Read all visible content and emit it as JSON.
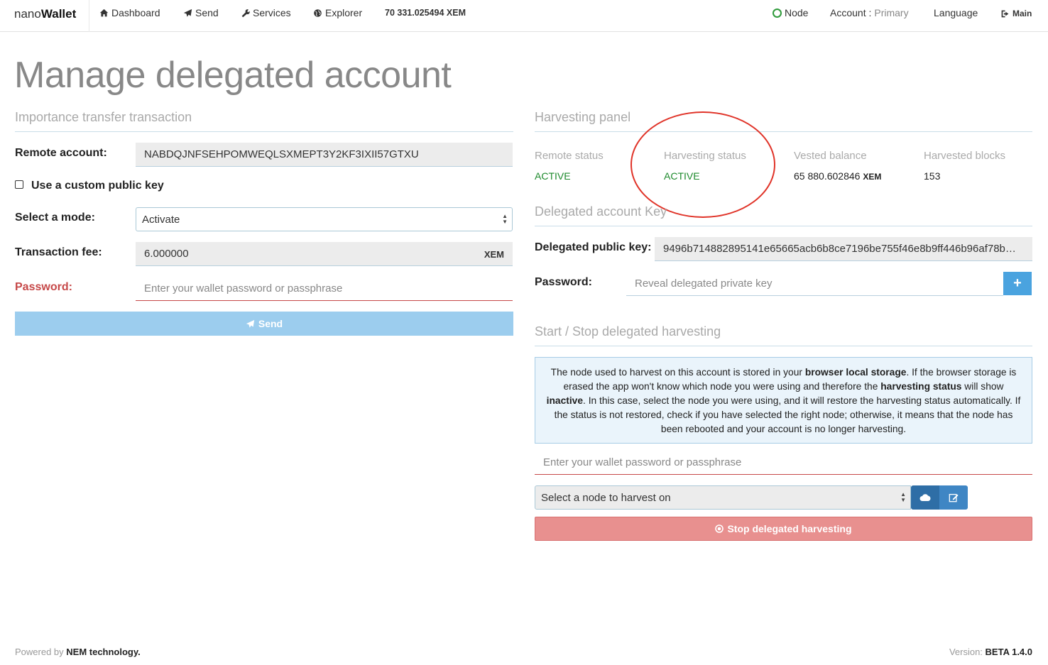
{
  "navbar": {
    "brand_light": "nano",
    "brand_bold": "Wallet",
    "dashboard": "Dashboard",
    "send": "Send",
    "services": "Services",
    "explorer": "Explorer",
    "balance": "70 331.025494 XEM",
    "node": "Node",
    "account_label": "Account : ",
    "account_name": "Primary",
    "language": "Language",
    "main": "Main"
  },
  "page": {
    "title": "Manage delegated account"
  },
  "importance": {
    "section_title": "Importance transfer transaction",
    "remote_label": "Remote account:",
    "remote_value": "NABDQJNFSEHPOMWEQLSXMEPT3Y2KF3IXII57GTXU",
    "custom_key_label": "Use a custom public key",
    "mode_label": "Select a mode:",
    "mode_value": "Activate",
    "fee_label": "Transaction fee:",
    "fee_value": "6.000000",
    "fee_unit": "XEM",
    "password_label": "Password:",
    "password_placeholder": "Enter your wallet password or passphrase",
    "send_button": "Send"
  },
  "harvesting": {
    "section_title": "Harvesting panel",
    "remote_status_label": "Remote status",
    "remote_status_value": "ACTIVE",
    "harvest_status_label": "Harvesting status",
    "harvest_status_value": "ACTIVE",
    "vested_label": "Vested balance",
    "vested_value": "65 880.602846",
    "vested_unit": "XEM",
    "blocks_label": "Harvested blocks",
    "blocks_value": "153"
  },
  "delegated_key": {
    "section_title": "Delegated account Key",
    "pubkey_label": "Delegated public key:",
    "pubkey_value": "9496b714882895141e65665acb6b8ce7196be755f46e8b9ff446b96af78b…",
    "password_label": "Password:",
    "password_placeholder": "Reveal delegated private key"
  },
  "start_stop": {
    "section_title": "Start / Stop delegated harvesting",
    "info": {
      "p1": "The node used to harvest on this account is stored in your ",
      "b1": "browser local storage",
      "p2": ". If the browser storage is erased the app won't know which node you were using and therefore the ",
      "b2": "harvesting status",
      "p3": " will show ",
      "b3": "inactive",
      "p4": ". In this case, select the node you were using, and it will restore the harvesting status automatically. If the status is not restored, check if you have selected the right node; otherwise, it means that the node has been rebooted and your account is no longer harvesting."
    },
    "password_placeholder": "Enter your wallet password or passphrase",
    "node_select": "Select a node to harvest on",
    "stop_button": "Stop delegated harvesting"
  },
  "footer": {
    "powered_by": "Powered by ",
    "powered_name": "NEM technology.",
    "version_label": "Version: ",
    "version_value": "BETA 1.4.0"
  }
}
